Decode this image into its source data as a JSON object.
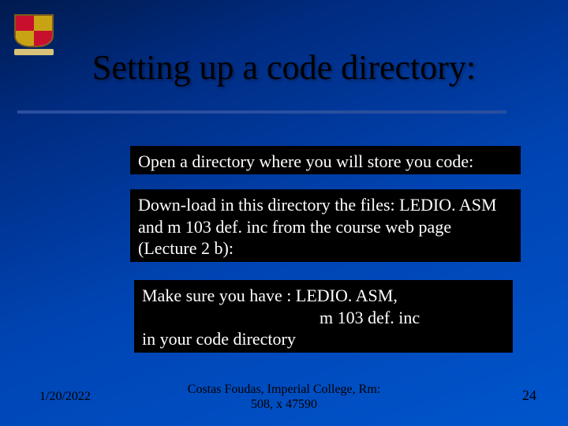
{
  "title": "Setting up a code directory:",
  "boxes": {
    "b1": "Open a directory where you will store you code:",
    "b2": "Down-load in this directory the files: LEDIO. ASM and m 103 def. inc from the course web page  (Lecture 2 b):",
    "b3_line1": "Make sure you have  : LEDIO. ASM,",
    "b3_line2": "m 103 def. inc",
    "b3_line3": "in your code directory"
  },
  "footer": {
    "date": "1/20/2022",
    "center_line1": "Costas Foudas, Imperial College, Rm:",
    "center_line2": "508, x 47590",
    "page": "24"
  }
}
